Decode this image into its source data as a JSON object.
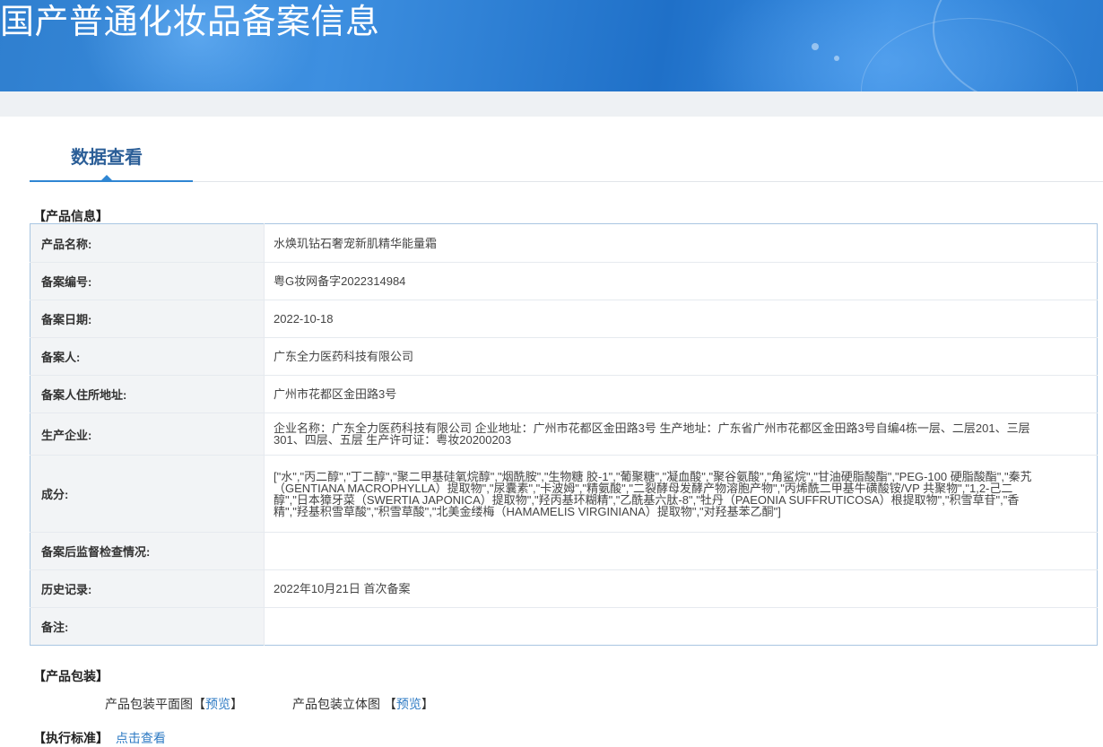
{
  "header": {
    "title": "国产普通化妆品备案信息"
  },
  "tabs": [
    {
      "label": "数据查看"
    }
  ],
  "product_info": {
    "section_title": "【产品信息】",
    "rows": [
      {
        "key": "产品名称:",
        "value": "水焕玑钻石奢宠新肌精华能量霜"
      },
      {
        "key": "备案编号:",
        "value": "粤G妆网备字2022314984"
      },
      {
        "key": "备案日期:",
        "value": "2022-10-18"
      },
      {
        "key": "备案人:",
        "value": "广东全力医药科技有限公司"
      },
      {
        "key": "备案人住所地址:",
        "value": "广州市花都区金田路3号"
      },
      {
        "key": "生产企业:",
        "value": "企业名称：广东全力医药科技有限公司 企业地址：广州市花都区金田路3号 生产地址：广东省广州市花都区金田路3号自编4栋一层、二层201、三层301、四层、五层 生产许可证：粤妆20200203"
      },
      {
        "key": "成分:",
        "value": "[\"水\",\"丙二醇\",\"丁二醇\",\"聚二甲基硅氧烷醇\",\"烟酰胺\",\"生物糖 胶-1\",\"葡聚糖\",\"凝血酸\",\"聚谷氨酸\",\"角鲨烷\",\"甘油硬脂酸酯\",\"PEG-100 硬脂酸酯\",\"秦艽（GENTIANA MACROPHYLLA）提取物\",\"尿囊素\",\"卡波姆\",\"精氨酸\",\"二裂酵母发酵产物溶胞产物\",\"丙烯酰二甲基牛磺酸铵/VP 共聚物\",\"1,2-己二醇\",\"日本獐牙菜（SWERTIA JAPONICA）提取物\",\"羟丙基环糊精\",\"乙酰基六肽-8\",\"牡丹（PAEONIA SUFFRUTICOSA）根提取物\",\"积雪草苷\",\"香精\",\"羟基积雪草酸\",\"积雪草酸\",\"北美金缕梅（HAMAMELIS VIRGINIANA）提取物\",\"对羟基苯乙酮\"]"
      },
      {
        "key": "备案后监督检查情况:",
        "value": ""
      },
      {
        "key": "历史记录:",
        "value": "2022年10月21日 首次备案"
      },
      {
        "key": "备注:",
        "value": ""
      }
    ]
  },
  "packaging": {
    "section_title": "【产品包装】",
    "flat_label": "产品包装平面图",
    "flat_preview": "预览",
    "solid_label": "产品包装立体图",
    "solid_preview": "预览",
    "bracket_open": "【",
    "bracket_close": "】"
  },
  "standard": {
    "section_title": "【执行标准】",
    "link": "点击查看"
  }
}
